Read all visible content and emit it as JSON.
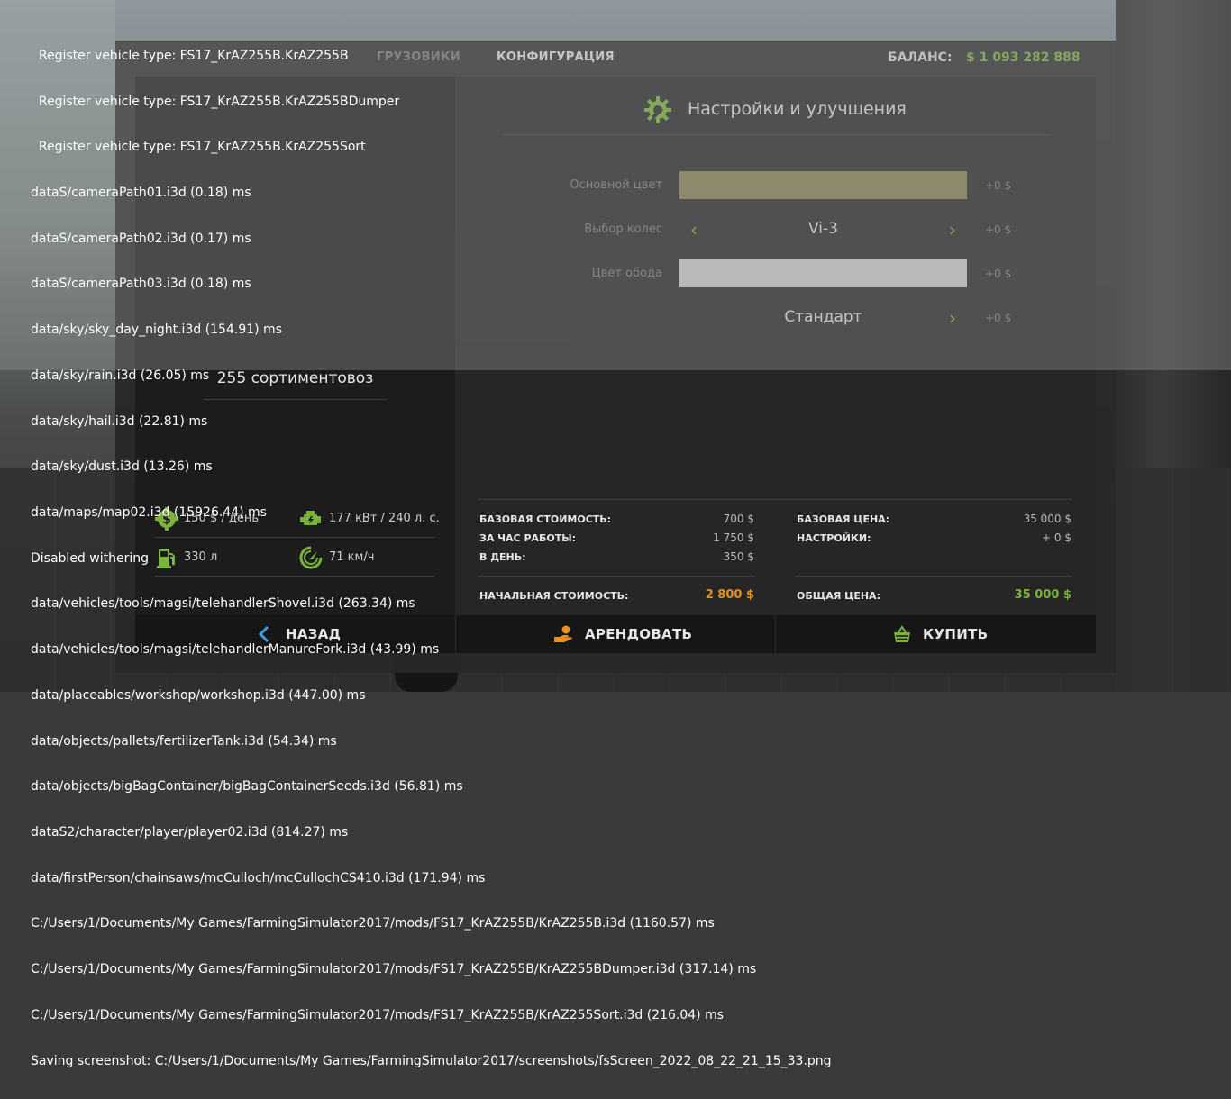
{
  "header": {
    "tab_trucks": "ГРУЗОВИКИ",
    "tab_config": "КОНФИГУРАЦИЯ",
    "balance_label": "БАЛАНС:",
    "balance_value": "$ 1 093 282 888"
  },
  "config": {
    "title": "Настройки и улучшения",
    "options": [
      {
        "label": "Основной цвет",
        "price": "+0 $",
        "color": "#8c8453"
      },
      {
        "label": "Выбор колес",
        "value": "Vi-3",
        "price": "+0 $"
      },
      {
        "label": "Цвет обода",
        "price": "+0 $",
        "color": "#cfcfcf"
      },
      {
        "label": "",
        "value": "Стандарт",
        "price": "+0 $"
      }
    ]
  },
  "vehicle": {
    "name": "255 сортиментовоз",
    "specs": {
      "maintenance": "150 $ / день",
      "power": "177 кВт / 240 л. с.",
      "fuel": "330 л",
      "speed": "71 км/ч"
    }
  },
  "costs": {
    "base_cost_label": "БАЗОВАЯ СТОИМОСТЬ:",
    "base_cost_value": "700 $",
    "per_hour_label": "ЗА ЧАС РАБОТЫ:",
    "per_hour_value": "1 750 $",
    "per_day_label": "В ДЕНЬ:",
    "per_day_value": "350 $",
    "initial_cost_label": "НАЧАЛЬНАЯ СТОИМОСТЬ:",
    "initial_cost_value": "2 800 $",
    "base_price_label": "БАЗОВАЯ ЦЕНА:",
    "base_price_value": "35 000 $",
    "settings_label": "НАСТРОЙКИ:",
    "settings_value": "+ 0 $",
    "total_label": "ОБЩАЯ ЦЕНА:",
    "total_value": "35 000 $"
  },
  "buttons": {
    "back": "НАЗАД",
    "rent": "АРЕНДОВАТЬ",
    "buy": "КУПИТЬ"
  },
  "colors": {
    "accent_green": "#79b33a",
    "accent_orange": "#e8901e"
  },
  "log": [
    "  Register vehicle type: FS17_KrAZ255B.KrAZ255B",
    "  Register vehicle type: FS17_KrAZ255B.KrAZ255BDumper",
    "  Register vehicle type: FS17_KrAZ255B.KrAZ255Sort",
    "dataS/cameraPath01.i3d (0.18) ms",
    "dataS/cameraPath02.i3d (0.17) ms",
    "dataS/cameraPath03.i3d (0.18) ms",
    "data/sky/sky_day_night.i3d (154.91) ms",
    "data/sky/rain.i3d (26.05) ms",
    "data/sky/hail.i3d (22.81) ms",
    "data/sky/dust.i3d (13.26) ms",
    "data/maps/map02.i3d (15926.44) ms",
    "Disabled withering",
    "data/vehicles/tools/magsi/telehandlerShovel.i3d (263.34) ms",
    "data/vehicles/tools/magsi/telehandlerManureFork.i3d (43.99) ms",
    "data/placeables/workshop/workshop.i3d (447.00) ms",
    "data/objects/pallets/fertilizerTank.i3d (54.34) ms",
    "data/objects/bigBagContainer/bigBagContainerSeeds.i3d (56.81) ms",
    "dataS2/character/player/player02.i3d (814.27) ms",
    "data/firstPerson/chainsaws/mcCulloch/mcCullochCS410.i3d (171.94) ms",
    "C:/Users/1/Documents/My Games/FarmingSimulator2017/mods/FS17_KrAZ255B/KrAZ255B.i3d (1160.57) ms",
    "C:/Users/1/Documents/My Games/FarmingSimulator2017/mods/FS17_KrAZ255B/KrAZ255BDumper.i3d (317.14) ms",
    "C:/Users/1/Documents/My Games/FarmingSimulator2017/mods/FS17_KrAZ255B/KrAZ255Sort.i3d (216.04) ms",
    "Saving screenshot: C:/Users/1/Documents/My Games/FarmingSimulator2017/screenshots/fsScreen_2022_08_22_21_15_33.png"
  ]
}
